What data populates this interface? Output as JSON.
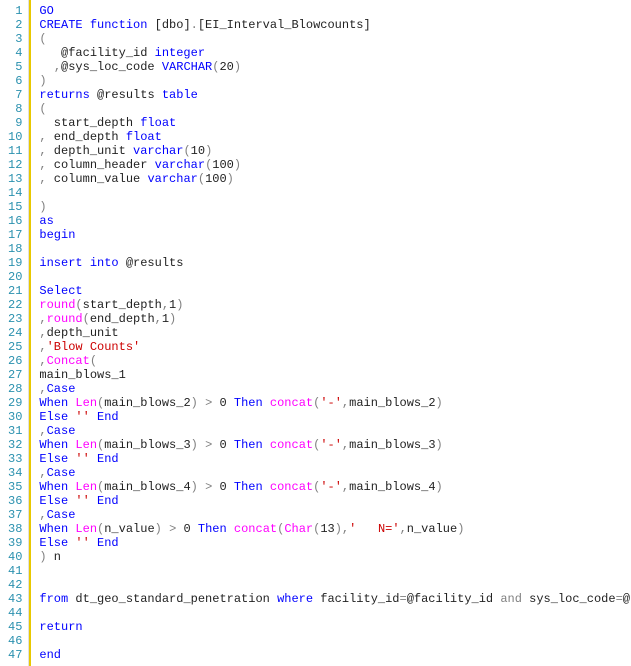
{
  "lines": [
    {
      "n": "1",
      "segs": [
        {
          "c": "kw",
          "t": "GO"
        }
      ]
    },
    {
      "n": "2",
      "segs": [
        {
          "c": "kw",
          "t": "CREATE function"
        },
        {
          "t": " [dbo]"
        },
        {
          "c": "gray",
          "t": "."
        },
        {
          "t": "[EI_Interval_Blowcounts]"
        }
      ]
    },
    {
      "n": "3",
      "segs": [
        {
          "c": "gray",
          "t": "("
        }
      ]
    },
    {
      "n": "4",
      "segs": [
        {
          "t": "   @facility_id "
        },
        {
          "c": "kw",
          "t": "integer"
        }
      ]
    },
    {
      "n": "5",
      "segs": [
        {
          "t": "  "
        },
        {
          "c": "gray",
          "t": ","
        },
        {
          "t": "@sys_loc_code "
        },
        {
          "c": "kw",
          "t": "VARCHAR"
        },
        {
          "c": "gray",
          "t": "("
        },
        {
          "t": "20"
        },
        {
          "c": "gray",
          "t": ")"
        }
      ]
    },
    {
      "n": "6",
      "segs": [
        {
          "c": "gray",
          "t": ")"
        }
      ]
    },
    {
      "n": "7",
      "segs": [
        {
          "c": "kw",
          "t": "returns"
        },
        {
          "t": " @results "
        },
        {
          "c": "kw",
          "t": "table"
        }
      ]
    },
    {
      "n": "8",
      "segs": [
        {
          "c": "gray",
          "t": "("
        }
      ]
    },
    {
      "n": "9",
      "segs": [
        {
          "t": "  start_depth "
        },
        {
          "c": "kw",
          "t": "float"
        }
      ]
    },
    {
      "n": "10",
      "segs": [
        {
          "c": "gray",
          "t": ","
        },
        {
          "t": " end_depth "
        },
        {
          "c": "kw",
          "t": "float"
        }
      ]
    },
    {
      "n": "11",
      "segs": [
        {
          "c": "gray",
          "t": ","
        },
        {
          "t": " depth_unit "
        },
        {
          "c": "kw",
          "t": "varchar"
        },
        {
          "c": "gray",
          "t": "("
        },
        {
          "t": "10"
        },
        {
          "c": "gray",
          "t": ")"
        }
      ]
    },
    {
      "n": "12",
      "segs": [
        {
          "c": "gray",
          "t": ","
        },
        {
          "t": " column_header "
        },
        {
          "c": "kw",
          "t": "varchar"
        },
        {
          "c": "gray",
          "t": "("
        },
        {
          "t": "100"
        },
        {
          "c": "gray",
          "t": ")"
        }
      ]
    },
    {
      "n": "13",
      "segs": [
        {
          "c": "gray",
          "t": ","
        },
        {
          "t": " column_value "
        },
        {
          "c": "kw",
          "t": "varchar"
        },
        {
          "c": "gray",
          "t": "("
        },
        {
          "t": "100"
        },
        {
          "c": "gray",
          "t": ")"
        }
      ]
    },
    {
      "n": "14",
      "segs": [
        {
          "t": ""
        }
      ]
    },
    {
      "n": "15",
      "segs": [
        {
          "c": "gray",
          "t": ")"
        }
      ]
    },
    {
      "n": "16",
      "segs": [
        {
          "c": "kw",
          "t": "as"
        }
      ]
    },
    {
      "n": "17",
      "segs": [
        {
          "c": "kw",
          "t": "begin"
        }
      ]
    },
    {
      "n": "18",
      "segs": [
        {
          "t": ""
        }
      ]
    },
    {
      "n": "19",
      "segs": [
        {
          "c": "kw",
          "t": "insert into"
        },
        {
          "t": " @results"
        }
      ]
    },
    {
      "n": "20",
      "segs": [
        {
          "t": ""
        }
      ]
    },
    {
      "n": "21",
      "segs": [
        {
          "c": "kw",
          "t": "Select"
        }
      ]
    },
    {
      "n": "22",
      "segs": [
        {
          "c": "func",
          "t": "round"
        },
        {
          "c": "gray",
          "t": "("
        },
        {
          "t": "start_depth"
        },
        {
          "c": "gray",
          "t": ","
        },
        {
          "t": "1"
        },
        {
          "c": "gray",
          "t": ")"
        }
      ]
    },
    {
      "n": "23",
      "segs": [
        {
          "c": "gray",
          "t": ","
        },
        {
          "c": "func",
          "t": "round"
        },
        {
          "c": "gray",
          "t": "("
        },
        {
          "t": "end_depth"
        },
        {
          "c": "gray",
          "t": ","
        },
        {
          "t": "1"
        },
        {
          "c": "gray",
          "t": ")"
        }
      ]
    },
    {
      "n": "24",
      "segs": [
        {
          "c": "gray",
          "t": ","
        },
        {
          "t": "depth_unit"
        }
      ]
    },
    {
      "n": "25",
      "segs": [
        {
          "c": "gray",
          "t": ","
        },
        {
          "c": "str",
          "t": "'Blow Counts'"
        }
      ]
    },
    {
      "n": "26",
      "segs": [
        {
          "c": "gray",
          "t": ","
        },
        {
          "c": "func",
          "t": "Concat"
        },
        {
          "c": "gray",
          "t": "("
        }
      ]
    },
    {
      "n": "27",
      "segs": [
        {
          "t": "main_blows_1"
        }
      ]
    },
    {
      "n": "28",
      "segs": [
        {
          "c": "gray",
          "t": ","
        },
        {
          "c": "kw",
          "t": "Case"
        }
      ]
    },
    {
      "n": "29",
      "segs": [
        {
          "c": "kw",
          "t": "When"
        },
        {
          "t": " "
        },
        {
          "c": "func",
          "t": "Len"
        },
        {
          "c": "gray",
          "t": "("
        },
        {
          "t": "main_blows_2"
        },
        {
          "c": "gray",
          "t": ")"
        },
        {
          "t": " "
        },
        {
          "c": "gray",
          "t": ">"
        },
        {
          "t": " 0 "
        },
        {
          "c": "kw",
          "t": "Then"
        },
        {
          "t": " "
        },
        {
          "c": "func",
          "t": "concat"
        },
        {
          "c": "gray",
          "t": "("
        },
        {
          "c": "str",
          "t": "'-'"
        },
        {
          "c": "gray",
          "t": ","
        },
        {
          "t": "main_blows_2"
        },
        {
          "c": "gray",
          "t": ")"
        }
      ]
    },
    {
      "n": "30",
      "segs": [
        {
          "c": "kw",
          "t": "Else"
        },
        {
          "t": " "
        },
        {
          "c": "str",
          "t": "''"
        },
        {
          "t": " "
        },
        {
          "c": "kw",
          "t": "End"
        }
      ]
    },
    {
      "n": "31",
      "segs": [
        {
          "c": "gray",
          "t": ","
        },
        {
          "c": "kw",
          "t": "Case"
        }
      ]
    },
    {
      "n": "32",
      "segs": [
        {
          "c": "kw",
          "t": "When"
        },
        {
          "t": " "
        },
        {
          "c": "func",
          "t": "Len"
        },
        {
          "c": "gray",
          "t": "("
        },
        {
          "t": "main_blows_3"
        },
        {
          "c": "gray",
          "t": ")"
        },
        {
          "t": " "
        },
        {
          "c": "gray",
          "t": ">"
        },
        {
          "t": " 0 "
        },
        {
          "c": "kw",
          "t": "Then"
        },
        {
          "t": " "
        },
        {
          "c": "func",
          "t": "concat"
        },
        {
          "c": "gray",
          "t": "("
        },
        {
          "c": "str",
          "t": "'-'"
        },
        {
          "c": "gray",
          "t": ","
        },
        {
          "t": "main_blows_3"
        },
        {
          "c": "gray",
          "t": ")"
        }
      ]
    },
    {
      "n": "33",
      "segs": [
        {
          "c": "kw",
          "t": "Else"
        },
        {
          "t": " "
        },
        {
          "c": "str",
          "t": "''"
        },
        {
          "t": " "
        },
        {
          "c": "kw",
          "t": "End"
        }
      ]
    },
    {
      "n": "34",
      "segs": [
        {
          "c": "gray",
          "t": ","
        },
        {
          "c": "kw",
          "t": "Case"
        }
      ]
    },
    {
      "n": "35",
      "segs": [
        {
          "c": "kw",
          "t": "When"
        },
        {
          "t": " "
        },
        {
          "c": "func",
          "t": "Len"
        },
        {
          "c": "gray",
          "t": "("
        },
        {
          "t": "main_blows_4"
        },
        {
          "c": "gray",
          "t": ")"
        },
        {
          "t": " "
        },
        {
          "c": "gray",
          "t": ">"
        },
        {
          "t": " 0 "
        },
        {
          "c": "kw",
          "t": "Then"
        },
        {
          "t": " "
        },
        {
          "c": "func",
          "t": "concat"
        },
        {
          "c": "gray",
          "t": "("
        },
        {
          "c": "str",
          "t": "'-'"
        },
        {
          "c": "gray",
          "t": ","
        },
        {
          "t": "main_blows_4"
        },
        {
          "c": "gray",
          "t": ")"
        }
      ]
    },
    {
      "n": "36",
      "segs": [
        {
          "c": "kw",
          "t": "Else"
        },
        {
          "t": " "
        },
        {
          "c": "str",
          "t": "''"
        },
        {
          "t": " "
        },
        {
          "c": "kw",
          "t": "End"
        }
      ]
    },
    {
      "n": "37",
      "segs": [
        {
          "c": "gray",
          "t": ","
        },
        {
          "c": "kw",
          "t": "Case"
        }
      ]
    },
    {
      "n": "38",
      "segs": [
        {
          "c": "kw",
          "t": "When"
        },
        {
          "t": " "
        },
        {
          "c": "func",
          "t": "Len"
        },
        {
          "c": "gray",
          "t": "("
        },
        {
          "t": "n_value"
        },
        {
          "c": "gray",
          "t": ")"
        },
        {
          "t": " "
        },
        {
          "c": "gray",
          "t": ">"
        },
        {
          "t": " 0 "
        },
        {
          "c": "kw",
          "t": "Then"
        },
        {
          "t": " "
        },
        {
          "c": "func",
          "t": "concat"
        },
        {
          "c": "gray",
          "t": "("
        },
        {
          "c": "func",
          "t": "Char"
        },
        {
          "c": "gray",
          "t": "("
        },
        {
          "t": "13"
        },
        {
          "c": "gray",
          "t": "),"
        },
        {
          "c": "str",
          "t": "'   N='"
        },
        {
          "c": "gray",
          "t": ","
        },
        {
          "t": "n_value"
        },
        {
          "c": "gray",
          "t": ")"
        }
      ]
    },
    {
      "n": "39",
      "segs": [
        {
          "c": "kw",
          "t": "Else"
        },
        {
          "t": " "
        },
        {
          "c": "str",
          "t": "''"
        },
        {
          "t": " "
        },
        {
          "c": "kw",
          "t": "End"
        }
      ]
    },
    {
      "n": "40",
      "segs": [
        {
          "c": "gray",
          "t": ")"
        },
        {
          "t": " n"
        }
      ]
    },
    {
      "n": "41",
      "segs": [
        {
          "t": ""
        }
      ]
    },
    {
      "n": "42",
      "segs": [
        {
          "t": ""
        }
      ]
    },
    {
      "n": "43",
      "segs": [
        {
          "c": "kw",
          "t": "from"
        },
        {
          "t": " dt_geo_standard_penetration "
        },
        {
          "c": "kw",
          "t": "where"
        },
        {
          "t": " facility_id"
        },
        {
          "c": "gray",
          "t": "="
        },
        {
          "t": "@facility_id "
        },
        {
          "c": "gray",
          "t": "and"
        },
        {
          "t": " sys_loc_code"
        },
        {
          "c": "gray",
          "t": "="
        },
        {
          "t": "@sys_loc_code"
        }
      ]
    },
    {
      "n": "44",
      "segs": [
        {
          "t": ""
        }
      ]
    },
    {
      "n": "45",
      "segs": [
        {
          "c": "kw",
          "t": "return"
        }
      ]
    },
    {
      "n": "46",
      "segs": [
        {
          "t": ""
        }
      ]
    },
    {
      "n": "47",
      "segs": [
        {
          "c": "kw",
          "t": "end"
        }
      ]
    }
  ]
}
